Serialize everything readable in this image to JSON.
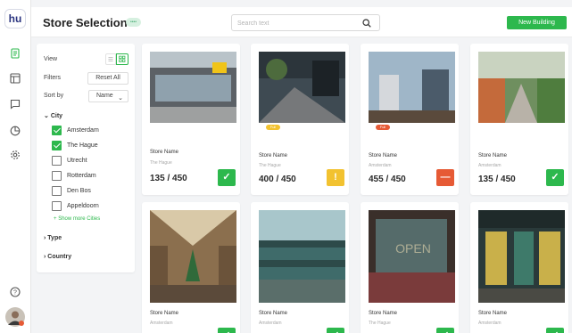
{
  "app": {
    "logo_text": "hu",
    "title": "Store Selection",
    "title_badge": "••••"
  },
  "search": {
    "placeholder": "Search text",
    "value": ""
  },
  "header": {
    "new_button": "New Building"
  },
  "filters": {
    "view_label": "View",
    "filters_label": "Filters",
    "reset_label": "Reset All",
    "sort_label": "Sort by",
    "sort_value": "Name",
    "city_heading": "City",
    "cities": [
      {
        "label": "Amsterdam",
        "checked": true
      },
      {
        "label": "The Hague",
        "checked": true
      },
      {
        "label": "Utrecht",
        "checked": false
      },
      {
        "label": "Rotterdam",
        "checked": false
      },
      {
        "label": "Den Bos",
        "checked": false
      },
      {
        "label": "Appeldoorn",
        "checked": false
      }
    ],
    "show_more": "Show more Cities",
    "type_heading": "Type",
    "country_heading": "Country"
  },
  "stores": [
    {
      "name": "Store Name",
      "city": "The Hague",
      "count": "135 / 450",
      "status": "ok",
      "status_icon": "check-icon"
    },
    {
      "name": "Store Name",
      "city": "The Hague",
      "count": "400 / 450",
      "status": "warn",
      "status_icon": "exclamation-icon",
      "photo_badge": "Full",
      "photo_badge_color": "#f2c230"
    },
    {
      "name": "Store Name",
      "city": "Amsterdam",
      "count": "455 / 450",
      "status": "bad",
      "status_icon": "minus-icon",
      "photo_badge": "Full",
      "photo_badge_color": "#e65a35"
    },
    {
      "name": "Store Name",
      "city": "Amsterdam",
      "count": "135 / 450",
      "status": "ok",
      "status_icon": "check-icon"
    },
    {
      "name": "Store Name",
      "city": "Amsterdam"
    },
    {
      "name": "Store Name",
      "city": "Amsterdam"
    },
    {
      "name": "Store Name",
      "city": "The Hague"
    },
    {
      "name": "Store Name",
      "city": "Amsterdam"
    }
  ],
  "colors": {
    "accent": "#2db84d",
    "warn": "#f2c230",
    "danger": "#e65a35",
    "brand": "#2b3580"
  }
}
